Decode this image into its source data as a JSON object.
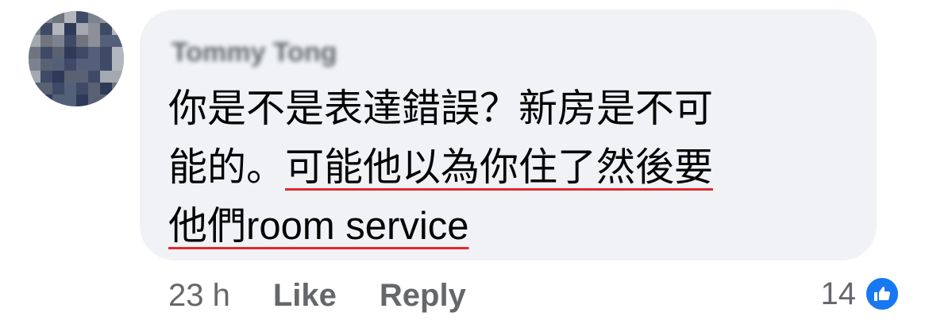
{
  "comment": {
    "author": "Tommy Tong",
    "lines": [
      {
        "plain": "你是不是表達錯誤？新房是不可",
        "underlined": ""
      },
      {
        "plain": "能的。",
        "underlined": "可能他以為你住了然後要"
      },
      {
        "plain": "",
        "underlined_cjk": "他們",
        "underlined_latin": "room service"
      }
    ],
    "underline_color": "#e0282e"
  },
  "actions": {
    "timestamp": "23 h",
    "like_label": "Like",
    "reply_label": "Reply"
  },
  "reactions": {
    "count": "14",
    "icon": "thumbs-up-icon",
    "badge_color": "#1877f2"
  }
}
